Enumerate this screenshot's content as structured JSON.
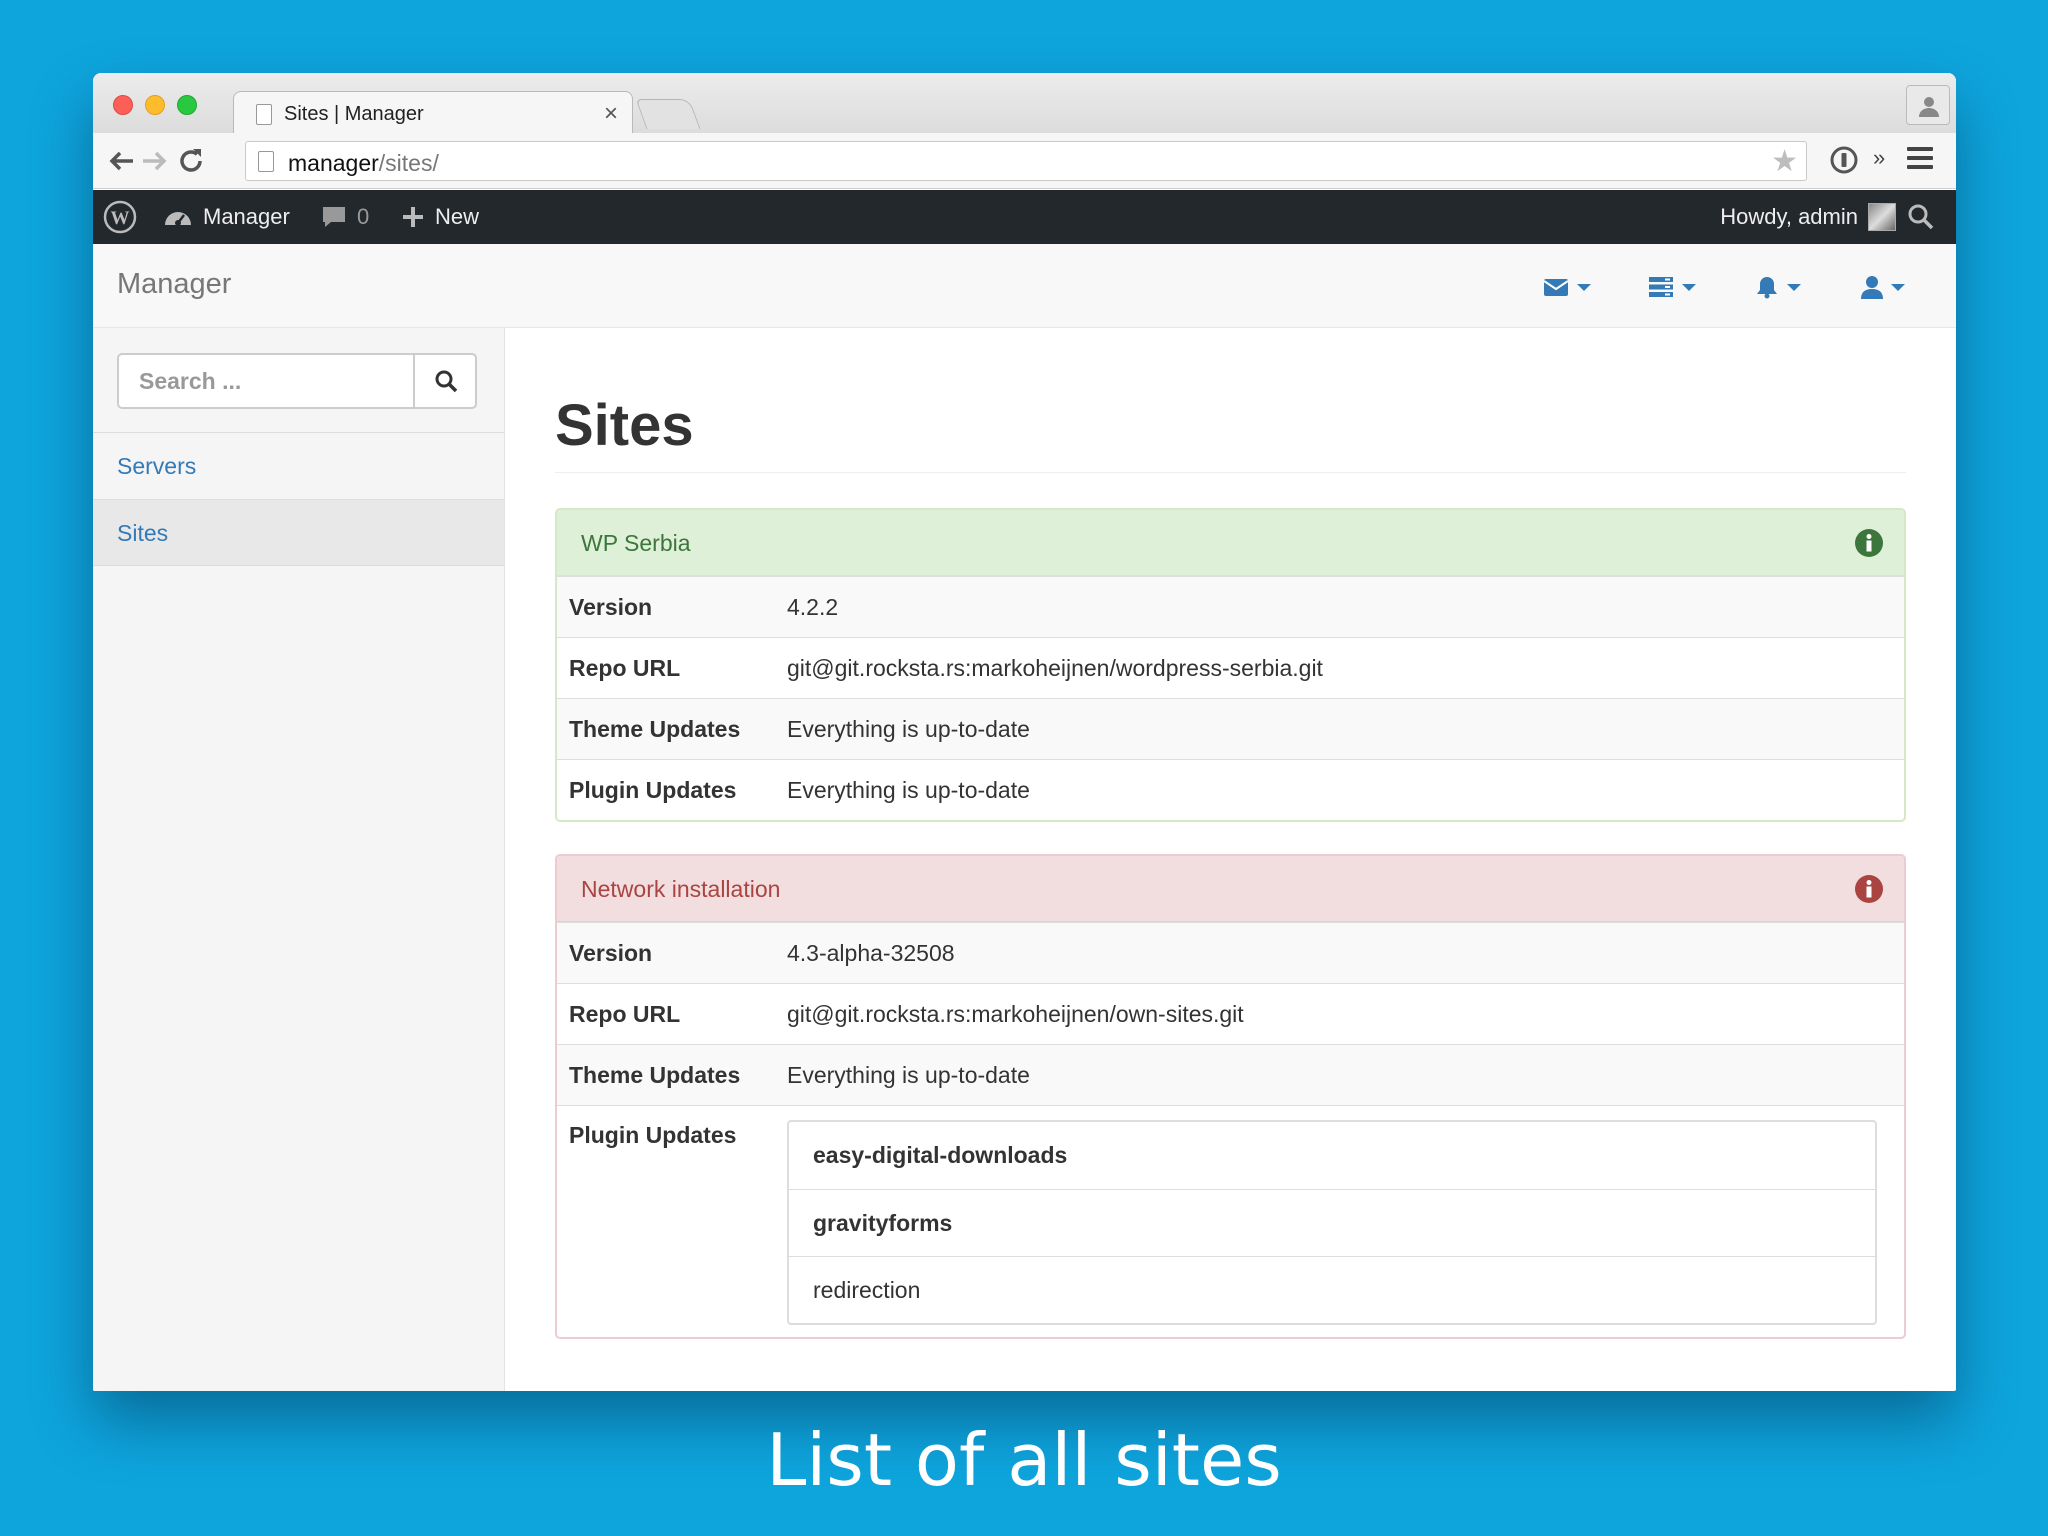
{
  "browser": {
    "tab_title": "Sites | Manager",
    "tab_close": "×",
    "url_host": "manager",
    "url_path": "/sites/",
    "overflow": "»"
  },
  "adminbar": {
    "site_name": "Manager",
    "comment_count": "0",
    "new_label": "New",
    "howdy": "Howdy, admin"
  },
  "navbar": {
    "brand": "Manager",
    "dropdowns": [
      "envelope-icon",
      "server-icon",
      "bell-icon",
      "user-icon"
    ]
  },
  "sidebar": {
    "search_placeholder": "Search ...",
    "items": [
      {
        "label": "Servers",
        "active": false
      },
      {
        "label": "Sites",
        "active": true
      }
    ]
  },
  "main": {
    "title": "Sites",
    "sites": [
      {
        "name": "WP Serbia",
        "status": "success",
        "rows": [
          {
            "key": "Version",
            "value": "4.2.2"
          },
          {
            "key": "Repo URL",
            "value": "git@git.rocksta.rs:markoheijnen/wordpress-serbia.git"
          },
          {
            "key": "Theme Updates",
            "value": "Everything is up-to-date"
          },
          {
            "key": "Plugin Updates",
            "value": "Everything is up-to-date"
          }
        ]
      },
      {
        "name": "Network installation",
        "status": "danger",
        "rows": [
          {
            "key": "Version",
            "value": "4.3-alpha-32508"
          },
          {
            "key": "Repo URL",
            "value": "git@git.rocksta.rs:markoheijnen/own-sites.git"
          },
          {
            "key": "Theme Updates",
            "value": "Everything is up-to-date"
          }
        ],
        "plugin_updates_label": "Plugin Updates",
        "plugins": [
          {
            "name": "easy-digital-downloads",
            "bold": true
          },
          {
            "name": "gravityforms",
            "bold": true
          },
          {
            "name": "redirection",
            "bold": false
          }
        ]
      }
    ]
  },
  "caption": "List of all sites",
  "colors": {
    "background": "#0ea5dd",
    "link": "#337ab7",
    "success": "#3c763d",
    "danger": "#a94442"
  }
}
